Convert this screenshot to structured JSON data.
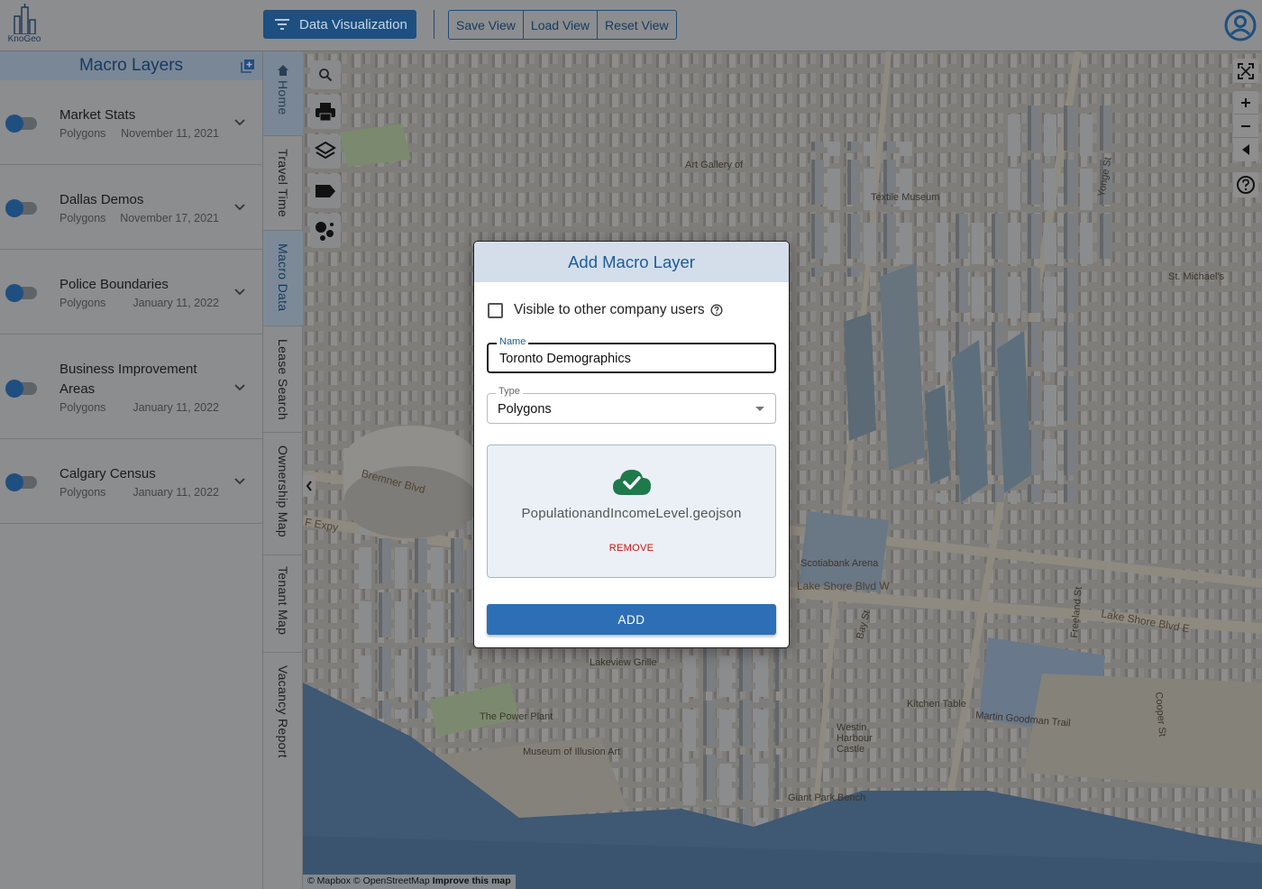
{
  "app": {
    "logo_text": "KnoGeo"
  },
  "toolbar": {
    "data_viz_label": "Data Visualization",
    "save_view": "Save View",
    "load_view": "Load View",
    "reset_view": "Reset View"
  },
  "left_panel": {
    "title": "Macro Layers",
    "layers": [
      {
        "name": "Market Stats",
        "type": "Polygons",
        "date": "November 11, 2021"
      },
      {
        "name": "Dallas Demos",
        "type": "Polygons",
        "date": "November 17, 2021"
      },
      {
        "name": "Police Boundaries",
        "type": "Polygons",
        "date": "January 11, 2022"
      },
      {
        "name": "Business Improvement Areas",
        "type": "Polygons",
        "date": "January 11, 2022"
      },
      {
        "name": "Calgary Census",
        "type": "Polygons",
        "date": "January 11, 2022"
      }
    ]
  },
  "vertical_tabs": [
    "Home",
    "Travel Time",
    "Macro Data",
    "Lease Search",
    "Ownership Map",
    "Tenant Map",
    "Vacancy Report"
  ],
  "map": {
    "labels": {
      "bremner": "Bremner Blvd",
      "expy": "F Expy",
      "lakeshore_w": "Lake Shore Blvd W",
      "lakeshore_e": "Lake Shore Blvd E",
      "martin_goodman": "Martin Goodman Trail",
      "freeland": "Freeland St",
      "cooper": "Cooper St",
      "bay": "Bay St",
      "power_plant": "The Power Plant",
      "museum": "Museum of Illusion Art",
      "kitchen_table": "Kitchen Table",
      "westin": "Westin Harbour Castle",
      "giant_park": "Giant Park Bench",
      "art_gallery": "Art Gallery of",
      "textile": "Textile Museum",
      "st_michaels": "St. Michael's",
      "lakeview_grille": "Lakeview Grille",
      "scotiabank": "Scotiabank Arena",
      "yonge": "Yonge St"
    },
    "attribution": "© Mapbox © OpenStreetMap",
    "attribution_link": "Improve this map"
  },
  "modal": {
    "title": "Add Macro Layer",
    "visible_label": "Visible to other company users",
    "name_label": "Name",
    "name_value": "Toronto Demographics",
    "type_label": "Type",
    "type_value": "Polygons",
    "file_name": "PopulationandIncomeLevel.geojson",
    "remove_label": "REMOVE",
    "add_label": "ADD"
  },
  "colors": {
    "primary": "#2c6fb6",
    "dark_primary": "#1d4f80",
    "remove": "#cc1111",
    "success": "#1e7a4a"
  }
}
